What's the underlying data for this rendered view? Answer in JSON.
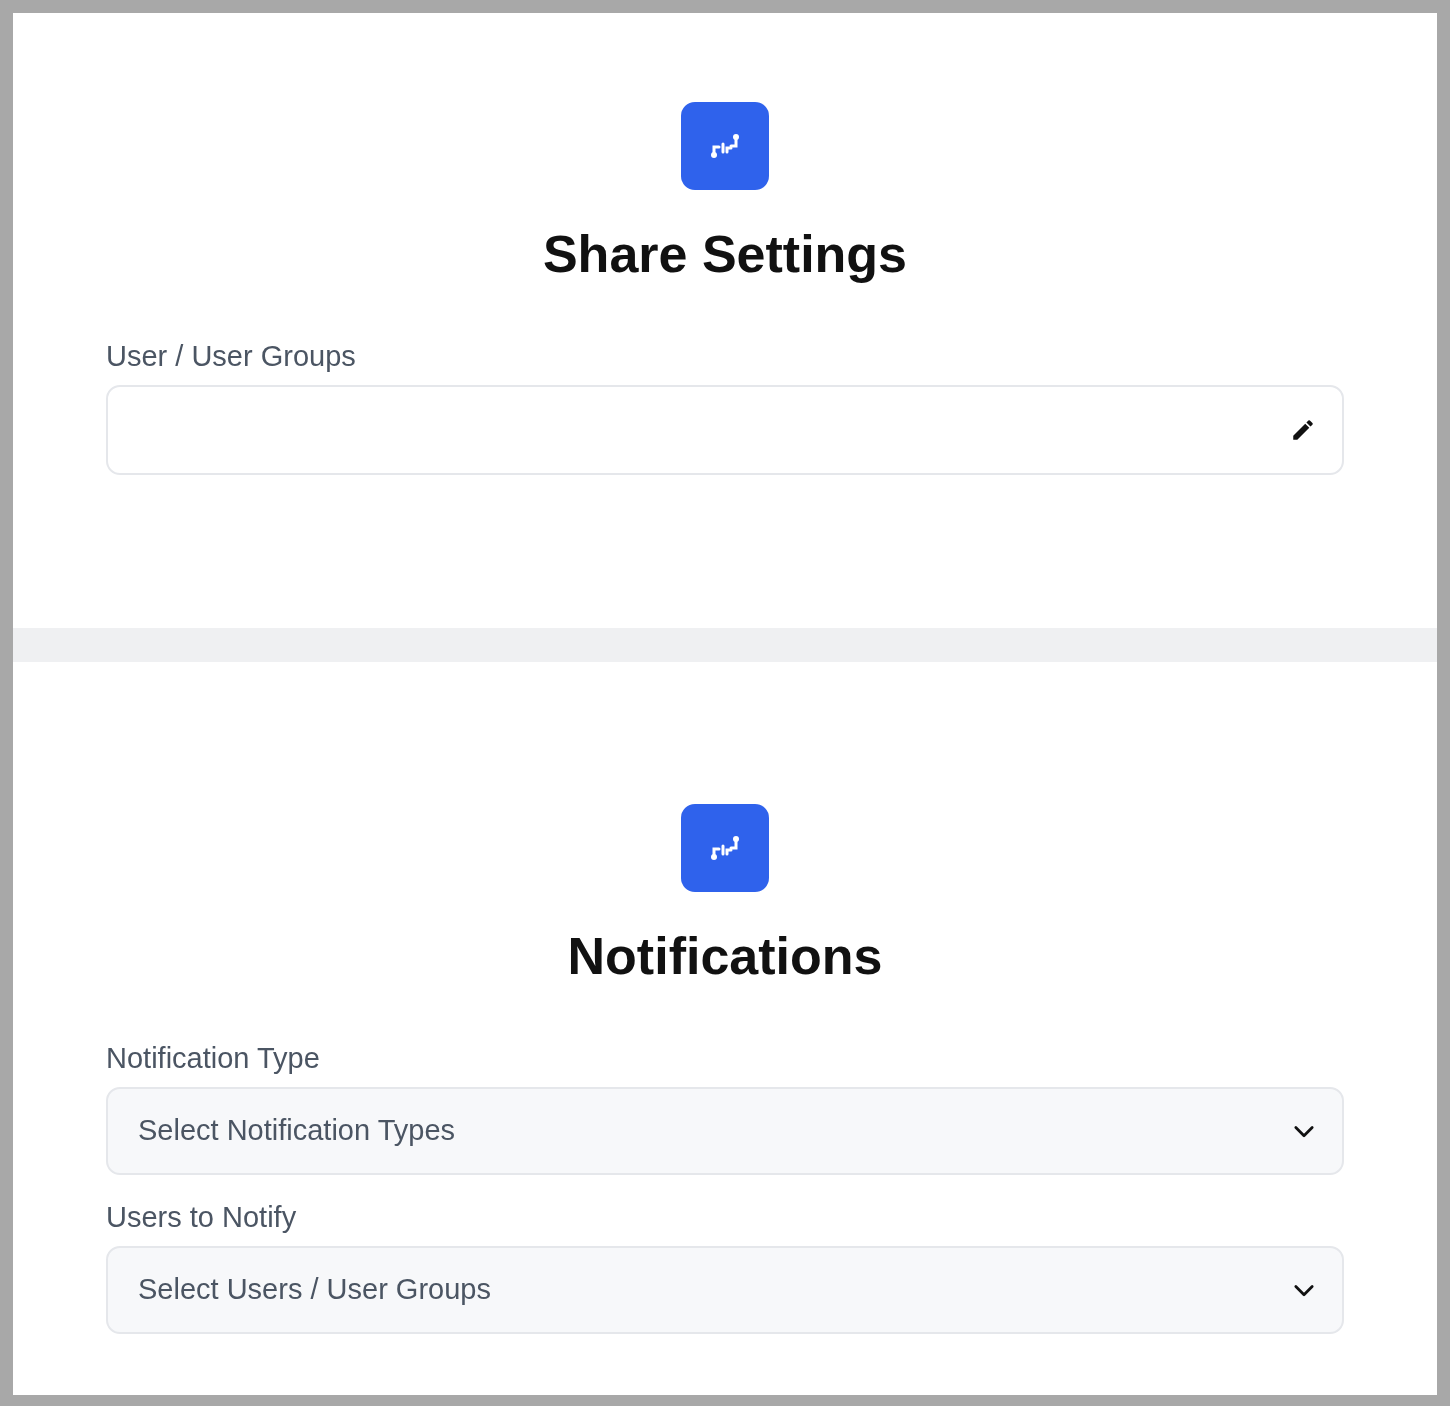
{
  "sections": [
    {
      "title": "Share Settings",
      "fields": [
        {
          "kind": "edit",
          "label": "User / User Groups"
        }
      ]
    },
    {
      "title": "Notifications",
      "fields": [
        {
          "kind": "select",
          "label": "Notification Type",
          "placeholder": "Select Notification Types"
        },
        {
          "kind": "select",
          "label": "Users to Notify",
          "placeholder": "Select Users / User Groups"
        }
      ]
    }
  ]
}
